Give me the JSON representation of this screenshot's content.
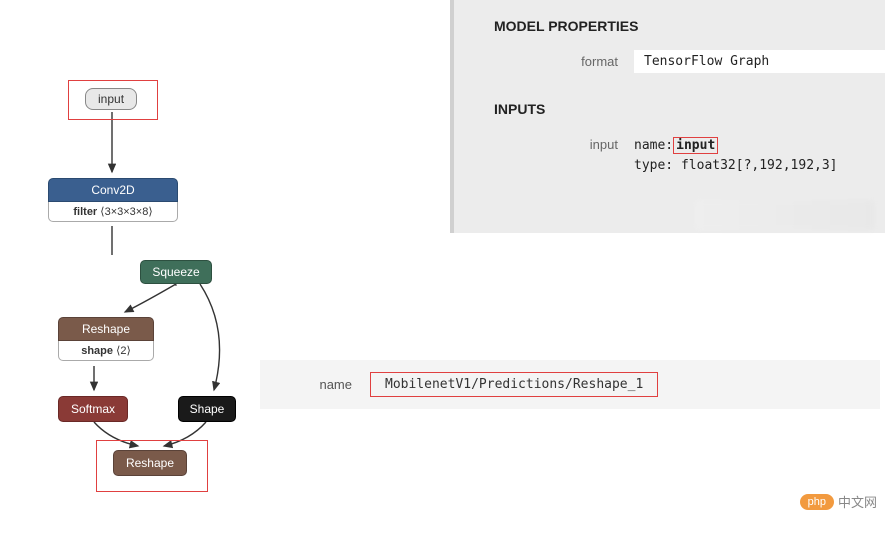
{
  "graph": {
    "input": {
      "label": "input"
    },
    "conv2d": {
      "title": "Conv2D",
      "filter_label": "filter",
      "filter_val": "⟨3×3×3×8⟩"
    },
    "squeeze": {
      "title": "Squeeze"
    },
    "reshape1": {
      "title": "Reshape",
      "shape_label": "shape",
      "shape_val": "⟨2⟩"
    },
    "softmax": {
      "title": "Softmax"
    },
    "shape": {
      "title": "Shape"
    },
    "reshape2": {
      "title": "Reshape"
    }
  },
  "props": {
    "section_model": "MODEL PROPERTIES",
    "format_label": "format",
    "format_value": "TensorFlow Graph",
    "section_inputs": "INPUTS",
    "input_label": "input",
    "name_label": "name:",
    "name_value": "input",
    "type_label": "type:",
    "type_value": "float32[?,192,192,3]"
  },
  "name_row": {
    "label": "name",
    "value": "MobilenetV1/Predictions/Reshape_1"
  },
  "logo": {
    "pill": "php",
    "text": "中文网"
  }
}
